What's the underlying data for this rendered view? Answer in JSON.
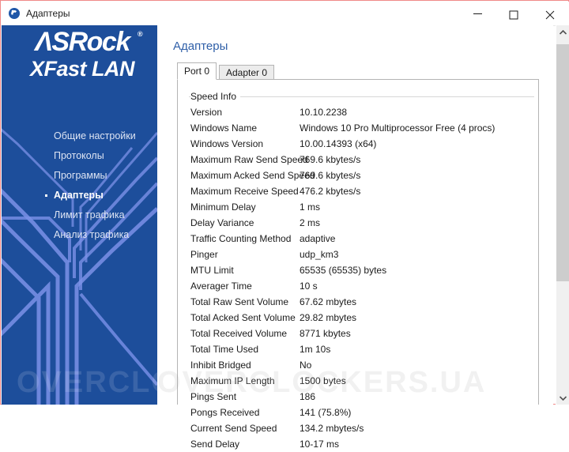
{
  "window": {
    "title": "Адаптеры",
    "icon": "asrock-app-icon",
    "minimize_label": "—",
    "maximize_label": "□",
    "close_label": "✕",
    "accent_blue": "#1d4e9b",
    "link_blue": "#2f5fa8"
  },
  "sidebar": {
    "logo": {
      "brand": "ΛSRock",
      "registered": "®",
      "product": "XFast LAN"
    },
    "items": [
      {
        "label": "Общие настройки",
        "active": false
      },
      {
        "label": "Протоколы",
        "active": false
      },
      {
        "label": "Программы",
        "active": false
      },
      {
        "label": "Адаптеры",
        "active": true
      },
      {
        "label": "Лимит трафика",
        "active": false
      },
      {
        "label": "Анализ трафика",
        "active": false
      }
    ]
  },
  "main": {
    "page_title": "Адаптеры",
    "tabs": [
      {
        "label": "Port 0",
        "selected": true
      },
      {
        "label": "Adapter 0",
        "selected": false
      }
    ],
    "group_title": "Speed Info",
    "rows": [
      {
        "label": "Version",
        "value": "10.10.2238"
      },
      {
        "label": "Windows Name",
        "value": "Windows 10 Pro Multiprocessor Free (4 procs)"
      },
      {
        "label": "Windows Version",
        "value": "10.00.14393 (x64)"
      },
      {
        "label": "Maximum Raw Send Speed",
        "value": "769.6 kbytes/s"
      },
      {
        "label": "Maximum Acked Send Speed",
        "value": "769.6 kbytes/s"
      },
      {
        "label": "Maximum Receive Speed",
        "value": "476.2 kbytes/s"
      },
      {
        "label": "Minimum Delay",
        "value": "1 ms"
      },
      {
        "label": "Delay Variance",
        "value": "2 ms"
      },
      {
        "label": "Traffic Counting Method",
        "value": "adaptive"
      },
      {
        "label": "Pinger",
        "value": "udp_km3"
      },
      {
        "label": "MTU Limit",
        "value": "65535 (65535) bytes"
      },
      {
        "label": "Averager Time",
        "value": "10 s"
      },
      {
        "label": "Total Raw Sent Volume",
        "value": "67.62 mbytes"
      },
      {
        "label": "Total Acked Sent Volume",
        "value": "29.82 mbytes"
      },
      {
        "label": "Total Received Volume",
        "value": "8771 kbytes"
      },
      {
        "label": "Total Time Used",
        "value": "1m 10s"
      },
      {
        "label": "Inhibit Bridged",
        "value": "No"
      },
      {
        "label": "Maximum IP Length",
        "value": "1500 bytes"
      },
      {
        "label": "Pings Sent",
        "value": "186"
      },
      {
        "label": "Pongs Received",
        "value": "141 (75.8%)"
      },
      {
        "label": "Current Send Speed",
        "value": "134.2 mbytes/s"
      },
      {
        "label": "Send Delay",
        "value": "10-17 ms"
      }
    ]
  },
  "watermark": {
    "text": "OVERCLOCKERS.UA"
  }
}
